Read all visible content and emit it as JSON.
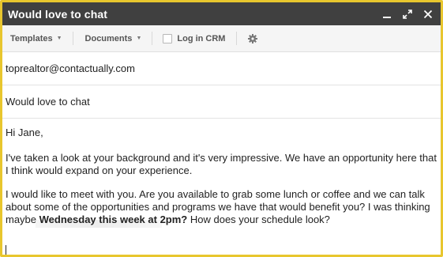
{
  "window": {
    "title": "Would love to chat",
    "border_color": "#e8c62e",
    "titlebar_color": "#404040"
  },
  "toolbar": {
    "templates_label": "Templates",
    "documents_label": "Documents",
    "crm_label": "Log in CRM",
    "crm_checked": false,
    "icons": [
      "chevron-down-icon",
      "checkbox-icon",
      "gear-icon"
    ]
  },
  "compose": {
    "to": "toprealtor@contactually.com",
    "subject": "Would love to chat",
    "greeting": "Hi Jane,",
    "paragraph1": "I've taken a look at your background and it's very impressive. We have an opportunity here that I think would expand on your experience.",
    "paragraph2_pre": "I would like to meet with you. Are you available to grab some lunch or coffee and we can talk about some of the opportunities and programs we have that would benefit you? I was thinking maybe ",
    "paragraph2_bold": "Wednesday this week at 2pm?",
    "paragraph2_post": " How does your schedule look?"
  }
}
